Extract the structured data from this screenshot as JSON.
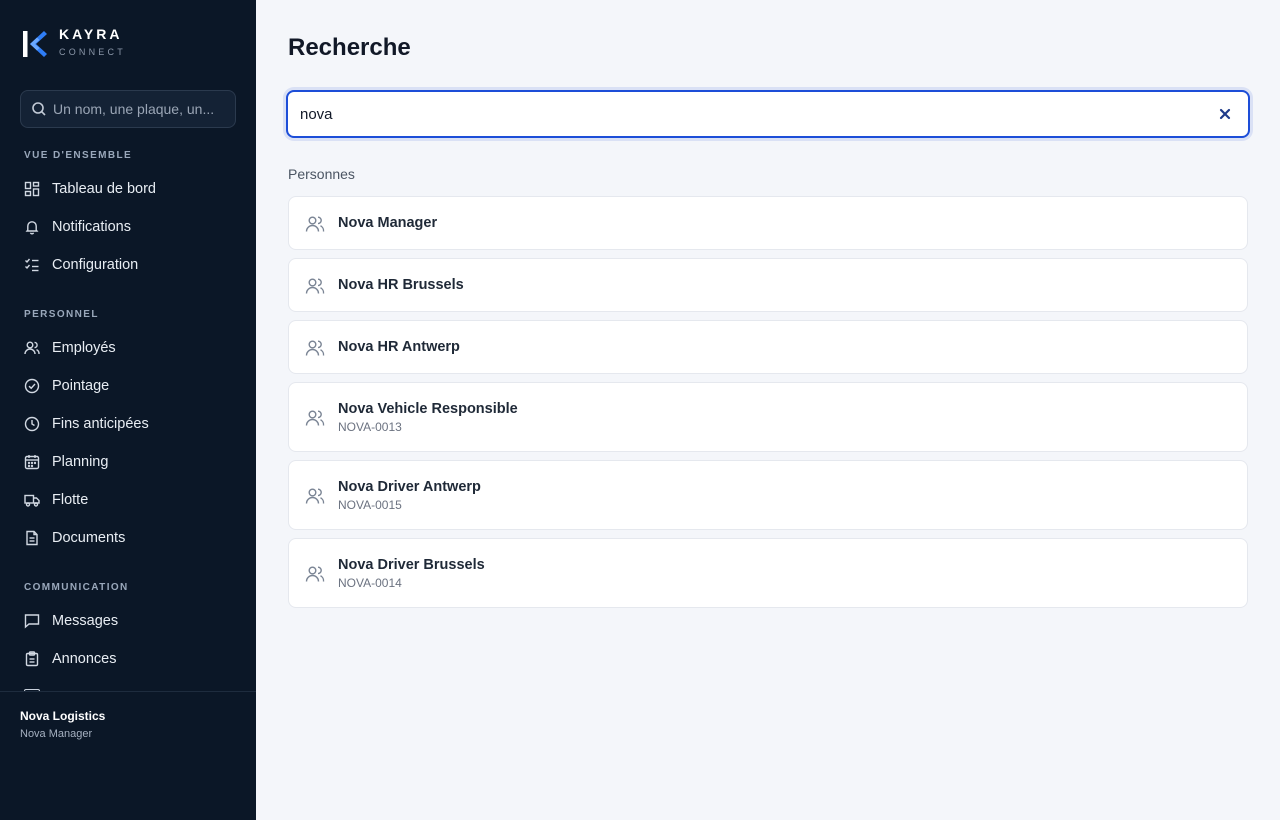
{
  "brand": {
    "name": "KAYRA",
    "subtitle": "CONNECT",
    "color": "#2f7df6"
  },
  "sidebar": {
    "search_placeholder": "Un nom, une plaque, un...",
    "sections": [
      {
        "label": "VUE D'ENSEMBLE",
        "items": [
          {
            "label": "Tableau de bord",
            "icon": "dashboard-icon"
          },
          {
            "label": "Notifications",
            "icon": "bell-icon"
          },
          {
            "label": "Configuration",
            "icon": "checklist-icon"
          }
        ]
      },
      {
        "label": "PERSONNEL",
        "items": [
          {
            "label": "Employés",
            "icon": "users-icon"
          },
          {
            "label": "Pointage",
            "icon": "check-circle-icon"
          },
          {
            "label": "Fins anticipées",
            "icon": "clock-icon"
          },
          {
            "label": "Planning",
            "icon": "calendar-icon"
          },
          {
            "label": "Flotte",
            "icon": "truck-icon"
          },
          {
            "label": "Documents",
            "icon": "document-icon"
          }
        ]
      },
      {
        "label": "COMMUNICATION",
        "items": [
          {
            "label": "Messages",
            "icon": "message-icon"
          },
          {
            "label": "Annonces",
            "icon": "clipboard-icon"
          }
        ]
      }
    ],
    "footer": {
      "org": "Nova Logistics",
      "user": "Nova Manager"
    }
  },
  "main": {
    "title": "Recherche",
    "search": {
      "value": "nova",
      "clear_icon": "close-icon"
    },
    "group_label": "Personnes",
    "results": [
      {
        "name": "Nova Manager",
        "sub": ""
      },
      {
        "name": "Nova HR Brussels",
        "sub": ""
      },
      {
        "name": "Nova HR Antwerp",
        "sub": ""
      },
      {
        "name": "Nova Vehicle Responsible",
        "sub": "NOVA-0013"
      },
      {
        "name": "Nova Driver Antwerp",
        "sub": "NOVA-0015"
      },
      {
        "name": "Nova Driver Brussels",
        "sub": "NOVA-0014"
      }
    ]
  },
  "colors": {
    "accent": "#1d4ed8",
    "sidebar_bg": "#0b1727",
    "page_bg": "#f4f6fa"
  }
}
